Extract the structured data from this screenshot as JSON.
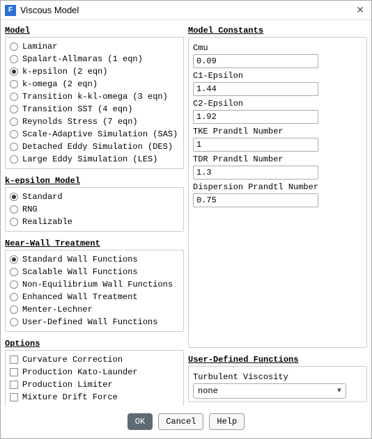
{
  "window": {
    "title": "Viscous Model",
    "icon_letter": "F"
  },
  "model": {
    "title": "Model",
    "options": [
      {
        "label": "Laminar",
        "selected": false
      },
      {
        "label": "Spalart-Allmaras (1 eqn)",
        "selected": false
      },
      {
        "label": "k-epsilon (2 eqn)",
        "selected": true
      },
      {
        "label": "k-omega (2 eqn)",
        "selected": false
      },
      {
        "label": "Transition k-kl-omega (3 eqn)",
        "selected": false
      },
      {
        "label": "Transition SST (4 eqn)",
        "selected": false
      },
      {
        "label": "Reynolds Stress (7 eqn)",
        "selected": false
      },
      {
        "label": "Scale-Adaptive Simulation (SAS)",
        "selected": false
      },
      {
        "label": "Detached Eddy Simulation (DES)",
        "selected": false
      },
      {
        "label": "Large Eddy Simulation (LES)",
        "selected": false
      }
    ]
  },
  "kepsilon": {
    "title": "k-epsilon Model",
    "options": [
      {
        "label": "Standard",
        "selected": true
      },
      {
        "label": "RNG",
        "selected": false
      },
      {
        "label": "Realizable",
        "selected": false
      }
    ]
  },
  "wall": {
    "title": "Near-Wall Treatment",
    "options": [
      {
        "label": "Standard Wall Functions",
        "selected": true
      },
      {
        "label": "Scalable Wall Functions",
        "selected": false
      },
      {
        "label": "Non-Equilibrium Wall Functions",
        "selected": false
      },
      {
        "label": "Enhanced Wall Treatment",
        "selected": false
      },
      {
        "label": "Menter-Lechner",
        "selected": false
      },
      {
        "label": "User-Defined Wall Functions",
        "selected": false
      }
    ]
  },
  "options": {
    "title": "Options",
    "items": [
      {
        "label": "Curvature Correction",
        "checked": false
      },
      {
        "label": "Production Kato-Launder",
        "checked": false
      },
      {
        "label": "Production Limiter",
        "checked": false
      },
      {
        "label": "Mixture Drift Force",
        "checked": false
      }
    ]
  },
  "constants": {
    "title": "Model Constants",
    "fields": [
      {
        "label": "Cmu",
        "value": "0.09"
      },
      {
        "label": "C1-Epsilon",
        "value": "1.44"
      },
      {
        "label": "C2-Epsilon",
        "value": "1.92"
      },
      {
        "label": "TKE Prandtl Number",
        "value": "1"
      },
      {
        "label": "TDR Prandtl Number",
        "value": "1.3"
      },
      {
        "label": "Dispersion Prandtl Number",
        "value": "0.75"
      }
    ]
  },
  "udf": {
    "title": "User-Defined Functions",
    "label": "Turbulent Viscosity",
    "value": "none"
  },
  "buttons": {
    "ok": "OK",
    "cancel": "Cancel",
    "help": "Help"
  }
}
